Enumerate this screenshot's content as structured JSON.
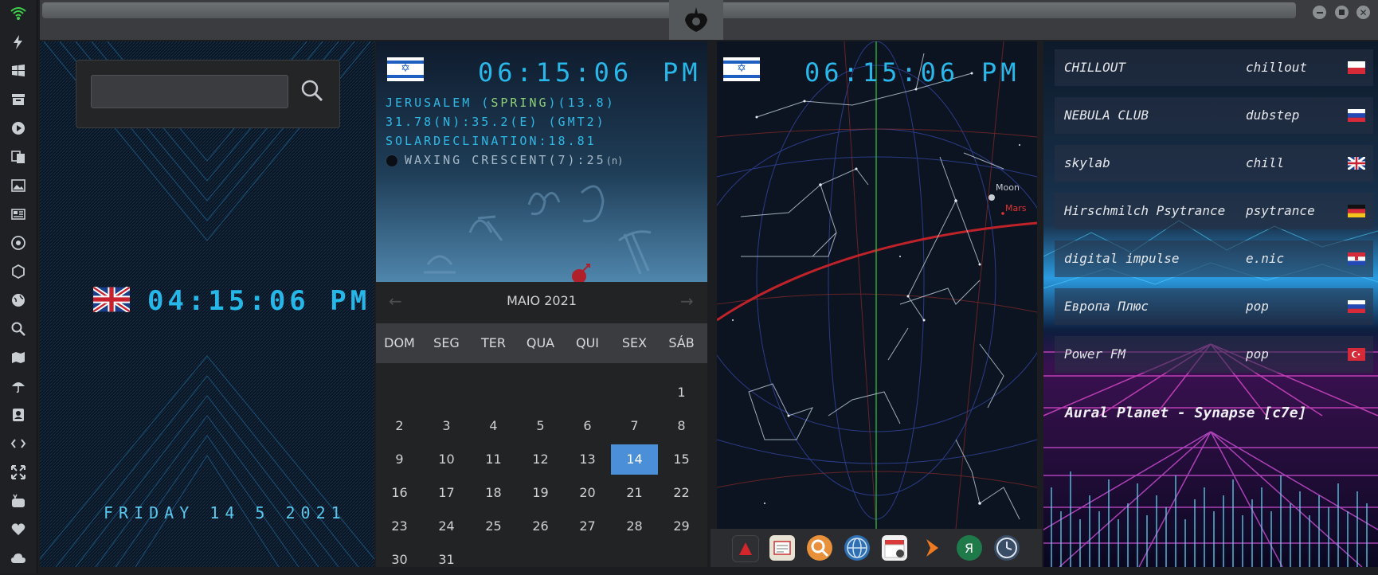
{
  "left_clock": {
    "search_placeholder": "",
    "time": "04:15:06 PM",
    "date": "FRIDAY 14 5 2021",
    "flag": "uk-flag-icon"
  },
  "astro": {
    "time": "06:15:06",
    "ampm": "PM",
    "line1_a": "JERUSALEM (",
    "line1_season": "SPRING",
    "line1_b": ")(13.8)",
    "line2": "31.78(N):35.2(E) (GMT2)",
    "line3": "SOLARDECLINATION:18.81",
    "line4": "WAXING CRESCENT(7):25",
    "line4_suffix": "(n)",
    "moon_icon": "moon-phase-icon"
  },
  "calendar": {
    "month": "MAIO 2021",
    "weekdays": [
      "DOM",
      "SEG",
      "TER",
      "QUA",
      "QUI",
      "SEX",
      "SÁB"
    ],
    "days": [
      "1",
      "2",
      "3",
      "4",
      "5",
      "6",
      "7",
      "8",
      "9",
      "10",
      "11",
      "12",
      "13",
      "14",
      "15",
      "16",
      "17",
      "18",
      "19",
      "20",
      "21",
      "22",
      "23",
      "24",
      "25",
      "26",
      "27",
      "28",
      "29",
      "30",
      "31"
    ],
    "selected": "14"
  },
  "sky": {
    "time": "06:15:06",
    "ampm": "PM",
    "moon_label": "Moon",
    "mars_label": "Mars"
  },
  "radio": {
    "stations": [
      {
        "name": "CHILLOUT",
        "genre": "chillout",
        "flag": "poland-flag-icon"
      },
      {
        "name": "NEBULA CLUB",
        "genre": "dubstep",
        "flag": "russia-flag-icon"
      },
      {
        "name": "skylab",
        "genre": "chill",
        "flag": "uk-flag-icon"
      },
      {
        "name": "Hirschmilch Psytrance",
        "genre": "psytrance",
        "flag": "germany-flag-icon"
      },
      {
        "name": "digital impulse",
        "genre": "e.nic",
        "flag": "croatia-flag-icon"
      },
      {
        "name": "Европа Плюс",
        "genre": "pop",
        "flag": "russia-flag-icon"
      },
      {
        "name": "Power FM",
        "genre": "pop",
        "flag": "turkey-flag-icon"
      }
    ],
    "now_playing": "Aural Planet - Synapse [c7e]"
  },
  "colors": {
    "lcd": "#25b7e8",
    "calendar_selected": "#4a8fd7",
    "ecliptic": "#c0222a",
    "meridian": "#22a83a"
  }
}
